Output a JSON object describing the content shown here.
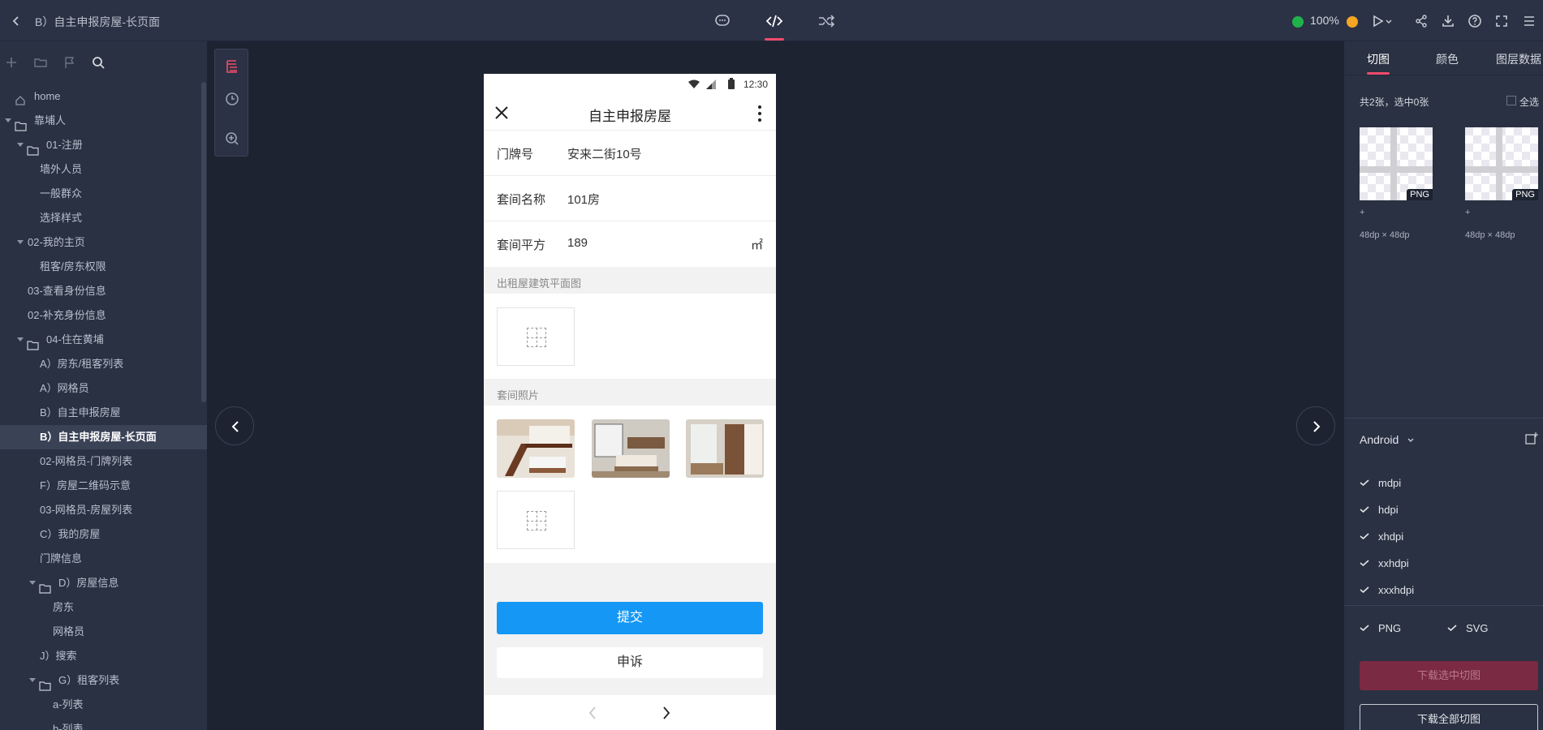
{
  "topbar": {
    "title": "B）自主申报房屋-长页面",
    "zoom": "100%"
  },
  "tree": {
    "items": [
      {
        "label": "home",
        "depth": 0,
        "type": "home"
      },
      {
        "label": "靠埔人",
        "depth": 0,
        "type": "folder"
      },
      {
        "label": "01-注册",
        "depth": 1,
        "type": "folder"
      },
      {
        "label": "墙外人员",
        "depth": 2,
        "type": "page"
      },
      {
        "label": "一般群众",
        "depth": 2,
        "type": "page"
      },
      {
        "label": "选择样式",
        "depth": 2,
        "type": "page"
      },
      {
        "label": "02-我的主页",
        "depth": 1,
        "type": "group"
      },
      {
        "label": "租客/房东权限",
        "depth": 2,
        "type": "page"
      },
      {
        "label": "03-查看身份信息",
        "depth": 1,
        "type": "page"
      },
      {
        "label": "02-补充身份信息",
        "depth": 1,
        "type": "page"
      },
      {
        "label": "04-住在黄埔",
        "depth": 1,
        "type": "folder"
      },
      {
        "label": "A）房东/租客列表",
        "depth": 2,
        "type": "page"
      },
      {
        "label": "A）网格员",
        "depth": 2,
        "type": "page"
      },
      {
        "label": "B）自主申报房屋",
        "depth": 2,
        "type": "page"
      },
      {
        "label": "B）自主申报房屋-长页面",
        "depth": 2,
        "type": "page",
        "active": true
      },
      {
        "label": "02-网格员-门牌列表",
        "depth": 2,
        "type": "page"
      },
      {
        "label": "F）房屋二维码示意",
        "depth": 2,
        "type": "page"
      },
      {
        "label": "03-网格员-房屋列表",
        "depth": 2,
        "type": "page"
      },
      {
        "label": "C）我的房屋",
        "depth": 2,
        "type": "page"
      },
      {
        "label": "门牌信息",
        "depth": 2,
        "type": "page"
      },
      {
        "label": "D）房屋信息",
        "depth": 2,
        "type": "folder"
      },
      {
        "label": "房东",
        "depth": 3,
        "type": "page"
      },
      {
        "label": "网格员",
        "depth": 3,
        "type": "page"
      },
      {
        "label": "J）搜索",
        "depth": 2,
        "type": "page"
      },
      {
        "label": "G）租客列表",
        "depth": 2,
        "type": "folder"
      },
      {
        "label": "a-列表",
        "depth": 3,
        "type": "page"
      },
      {
        "label": "b-列表",
        "depth": 3,
        "type": "page"
      }
    ]
  },
  "phone": {
    "status_time": "12:30",
    "title": "自主申报房屋",
    "fields": [
      {
        "label": "门牌号",
        "value": "安来二街10号",
        "unit": ""
      },
      {
        "label": "套间名称",
        "value": "101房",
        "unit": ""
      },
      {
        "label": "套间平方",
        "value": "189",
        "unit": "㎡"
      }
    ],
    "section_floorplan": "出租屋建筑平面图",
    "section_photos": "套间照片",
    "submit": "提交",
    "appeal": "申诉"
  },
  "rpanel": {
    "tabs": [
      "切图",
      "颜色",
      "图层数据"
    ],
    "count_text": "共2张，选中0张",
    "select_all": "全选",
    "thumbs": [
      {
        "badge": "PNG",
        "plus": "+",
        "size": "48dp × 48dp"
      },
      {
        "badge": "PNG",
        "plus": "+",
        "size": "48dp × 48dp"
      }
    ],
    "platform": "Android",
    "dpis": [
      "mdpi",
      "hdpi",
      "xhdpi",
      "xxhdpi",
      "xxxhdpi"
    ],
    "formats": [
      "PNG",
      "SVG"
    ],
    "download_selected": "下载选中切图",
    "download_all": "下载全部切图"
  },
  "colors": {
    "accent": "#f04b6a",
    "primary_button": "#1497f5",
    "topbar": "#2b3245",
    "sidebar": "#2a3142",
    "canvas": "#1d2331"
  }
}
